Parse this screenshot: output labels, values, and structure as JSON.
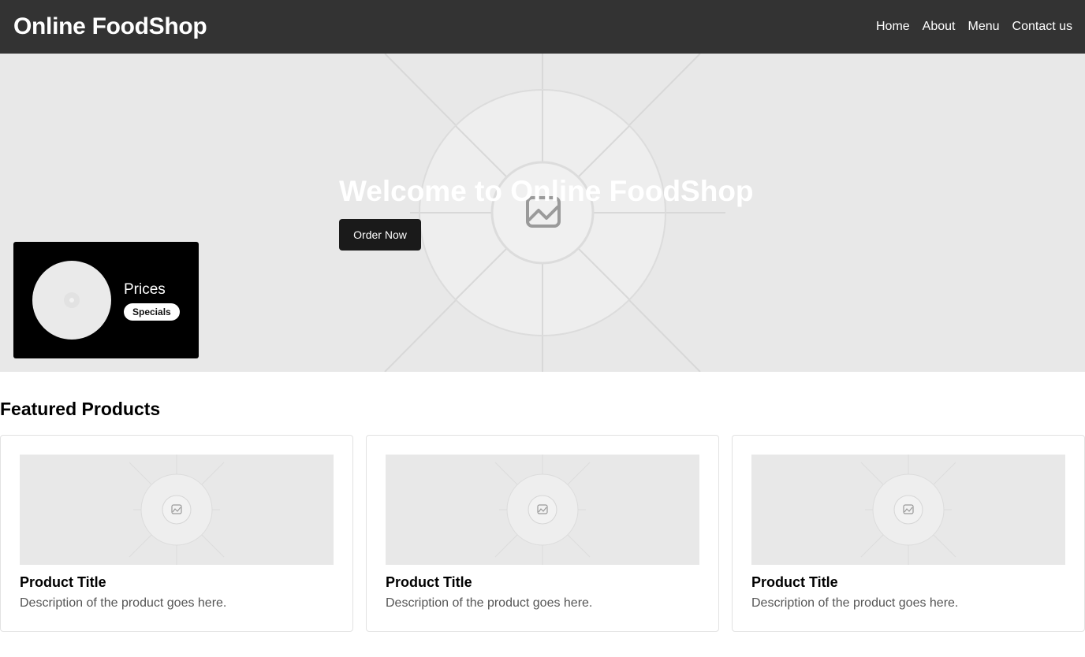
{
  "navbar": {
    "brand": "Online FoodShop",
    "links": [
      "Home",
      "About",
      "Menu",
      "Contact us"
    ]
  },
  "hero": {
    "title": "Welcome to Online FoodShop",
    "button_label": "Order Now",
    "image_icon": "image-placeholder-icon"
  },
  "promo": {
    "label": "Prices",
    "badge": "Specials"
  },
  "featured": {
    "title": "Featured Products",
    "products": [
      {
        "title": "Product Title",
        "description": "Description of the product goes here."
      },
      {
        "title": "Product Title",
        "description": "Description of the product goes here."
      },
      {
        "title": "Product Title",
        "description": "Description of the product goes here."
      }
    ]
  },
  "colors": {
    "navbar": "#333333",
    "hero_bg": "#e8e8e8",
    "button": "#1a1a1a",
    "promo_bg": "#000000"
  }
}
